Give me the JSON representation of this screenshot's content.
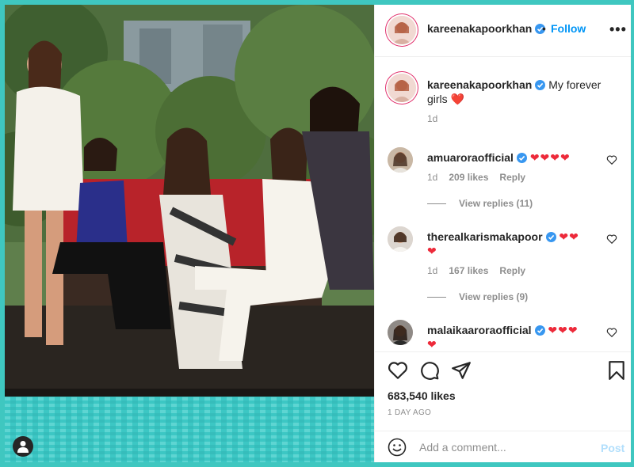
{
  "post": {
    "author": "kareenakapoorkhan",
    "follow_label": "Follow",
    "dot": "•",
    "more_label": "•••",
    "caption_text": "My forever girls",
    "caption_emoji": "❤️",
    "caption_time": "1d",
    "likes": "683,540 likes",
    "date": "1 DAY AGO"
  },
  "comments": [
    {
      "user": "amuarora official",
      "username": "amuaroraofficial",
      "hearts": "❤❤❤❤",
      "time": "1d",
      "likes": "209 likes",
      "reply_label": "Reply",
      "view_replies": "View replies (11)"
    },
    {
      "username": "therealkarismakapoor",
      "hearts": "❤❤",
      "hearts_line2": "❤",
      "time": "1d",
      "likes": "167 likes",
      "reply_label": "Reply",
      "view_replies": "View replies (9)"
    },
    {
      "username": "malaikaaroraofficial",
      "hearts": "❤❤❤",
      "hearts_line2": "❤"
    }
  ],
  "add_comment": {
    "placeholder": "Add a comment...",
    "post_label": "Post"
  },
  "icons": {
    "like": "heart-outline-icon",
    "comment": "speech-bubble-icon",
    "share": "paper-plane-icon",
    "save": "bookmark-icon",
    "emoji": "smiley-icon",
    "tag": "user-tag-icon"
  },
  "colors": {
    "accent": "#0095f6",
    "heart": "#ed2a3a",
    "border_teal": "#3fc7c0"
  }
}
